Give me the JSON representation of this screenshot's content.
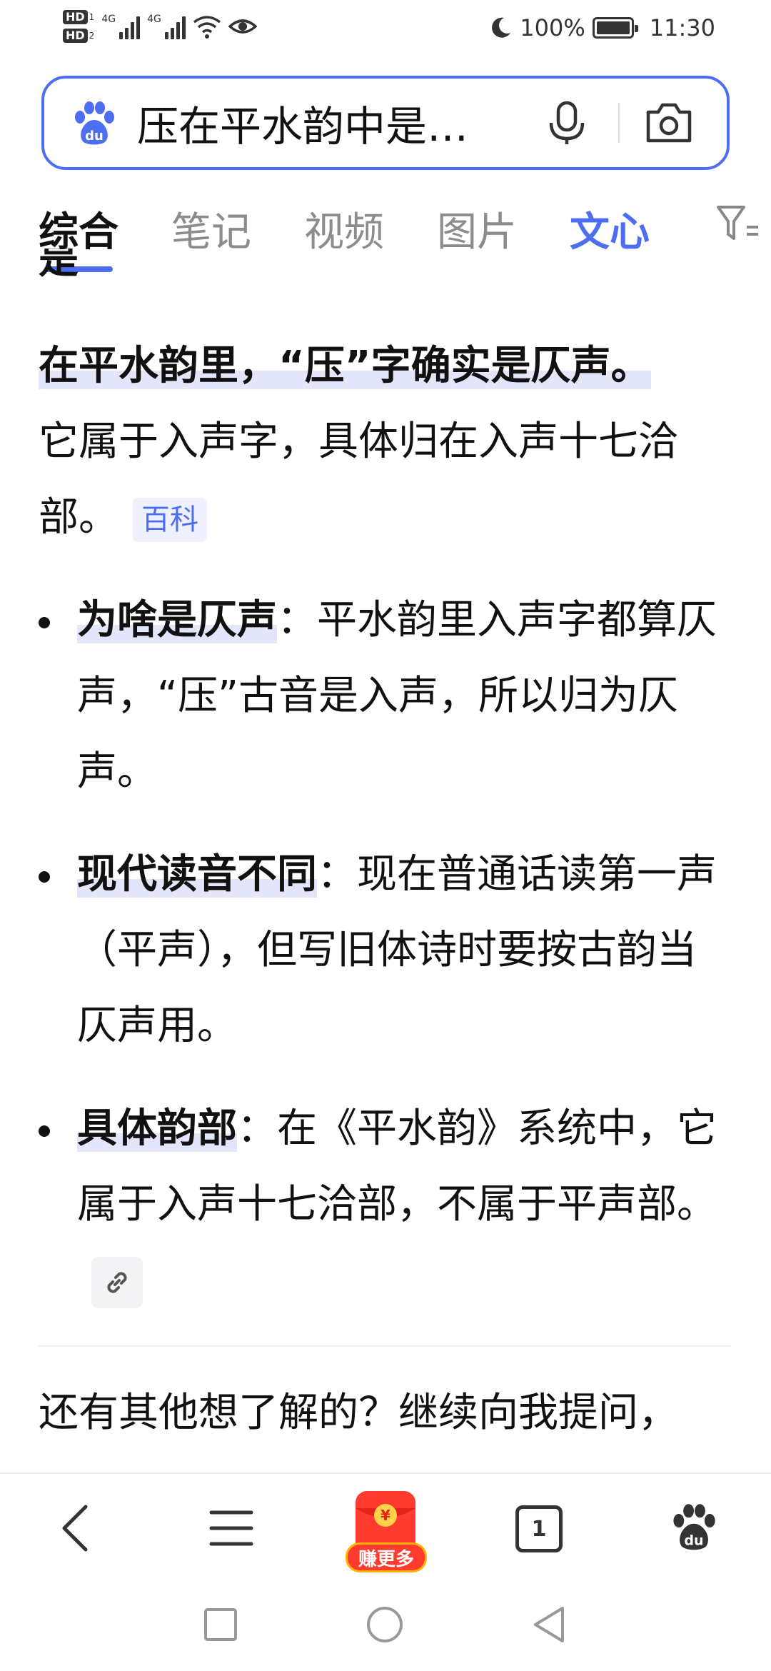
{
  "status_bar": {
    "hd1": "HD",
    "hd1_num": "1",
    "hd2": "HD",
    "hd2_num": "2",
    "net1": "4G",
    "net2": "4G",
    "battery": "100%",
    "time": "11:30"
  },
  "search": {
    "query": "压在平水韵中是仄声吗",
    "mic_icon": "microphone-icon",
    "camera_icon": "camera-icon",
    "logo_icon": "baidu-paw-icon",
    "accent": "#4e6ef2"
  },
  "tabs": [
    {
      "label": "综合",
      "active": true
    },
    {
      "label": "笔记"
    },
    {
      "label": "视频"
    },
    {
      "label": "图片"
    },
    {
      "label": "文心"
    }
  ],
  "clipped_text": "是",
  "answer": {
    "headline": "在平水韵里，“压”字确实是仄声。",
    "body": "它属于入声字，具体归在入声十七洽部。",
    "tag": "百科",
    "bullets": [
      {
        "title": "为啥是仄声",
        "text": "：平水韵里入声字都算仄声，“压”古音是入声，所以归为仄声。"
      },
      {
        "title": "现代读音不同",
        "text": "：现在普通话读第一声（平声），但写旧体诗时要按古韵当仄声用。"
      },
      {
        "title": "具体韵部",
        "text": "：在《平水韵》系统中，它属于入声十七洽部，不属于平声部。"
      }
    ],
    "followup": "还有其他想了解的？继续向我提问，"
  },
  "bottom_bar": {
    "back_icon": "back-chevron-icon",
    "menu_icon": "menu-icon",
    "redpacket_symbol": "¥",
    "redpacket_label": "赚更多",
    "tab_count": "1",
    "home_icon": "baidu-paw-icon"
  }
}
